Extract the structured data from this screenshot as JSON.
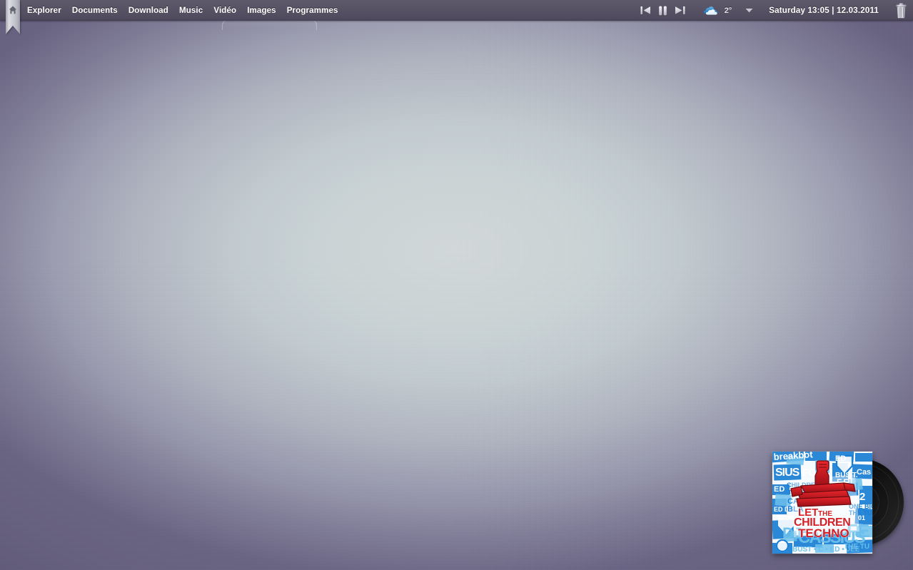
{
  "desktop": {
    "bg_center_color": "#d2dadb",
    "bg_edge_color": "#6f6a8a",
    "wallpaper_description": "radial light grey-blue to purple gradient"
  },
  "menubar": {
    "background_color": "#575264",
    "text_color": "#ffffff",
    "home_button": {
      "name": "home-ribbon",
      "icon": "home-icon",
      "color": "#c8c8cc"
    },
    "items": [
      {
        "label": "Explorer",
        "name": "menu-item-explorer"
      },
      {
        "label": "Documents",
        "name": "menu-item-documents"
      },
      {
        "label": "Download",
        "name": "menu-item-download"
      },
      {
        "label": "Music",
        "name": "menu-item-music"
      },
      {
        "label": "Vidéo",
        "name": "menu-item-video"
      },
      {
        "label": "Images",
        "name": "menu-item-images"
      },
      {
        "label": "Programmes",
        "name": "menu-item-programmes"
      }
    ],
    "media_controls": [
      {
        "name": "media-previous-button",
        "icon": "skip-previous-icon",
        "label": "Previous"
      },
      {
        "name": "media-pause-button",
        "icon": "pause-icon",
        "label": "Pause"
      },
      {
        "name": "media-next-button",
        "icon": "skip-next-icon",
        "label": "Next"
      }
    ],
    "weather": {
      "icon": "cloud-icon",
      "icon_color": "#2f8fd4",
      "temperature": "2°",
      "dropdown_icon": "chevron-down-icon"
    },
    "datetime": "Saturday 13:05 | 12.03.2011",
    "trash": {
      "name": "trash-icon",
      "label": "Trash"
    }
  },
  "album_widget": {
    "title_line1": "LET THE",
    "title_line2": "CHILDREN",
    "title_line3": "TECHNO",
    "artist": "CASSIUS",
    "cover_colors": {
      "blue": "#1b7fd4",
      "light_blue": "#6cc0ec",
      "red": "#d42026",
      "dark_red": "#8c1016",
      "white": "#ffffff"
    },
    "collage_words": [
      "breakbot",
      "CASSIUS",
      "FEA",
      "BUST",
      "THE TU",
      "CAR",
      "BLA",
      "DJ",
      "2",
      "01",
      "FEE"
    ],
    "vinyl": {
      "name": "vinyl-record",
      "color": "#111111"
    }
  }
}
